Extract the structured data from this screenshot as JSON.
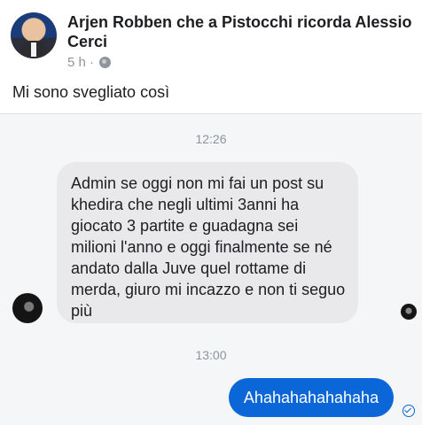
{
  "post": {
    "title": "Arjen Robben che a Pistocchi ricorda Alessio Cerci",
    "time": "5 h ·",
    "privacy_icon": "globe-icon",
    "text": "Mi sono svegliato così"
  },
  "chat": {
    "timestamp_1": "12:26",
    "incoming_message": "Admin se oggi non mi fai un post su khedira che negli ultimi 3anni ha giocato 3 partite e guadagna sei milioni l'anno e oggi finalmente se né andato dalla Juve quel rottame di merda, giuro mi incazzo e non ti seguo più",
    "timestamp_2": "13:00",
    "outgoing_message": "Ahahahahahahaha",
    "sent_icon": "check-circle-icon"
  },
  "colors": {
    "outgoing_bubble": "#0b67d8",
    "incoming_bubble": "#e9e9eb",
    "chat_background": "#f5f6f7"
  }
}
